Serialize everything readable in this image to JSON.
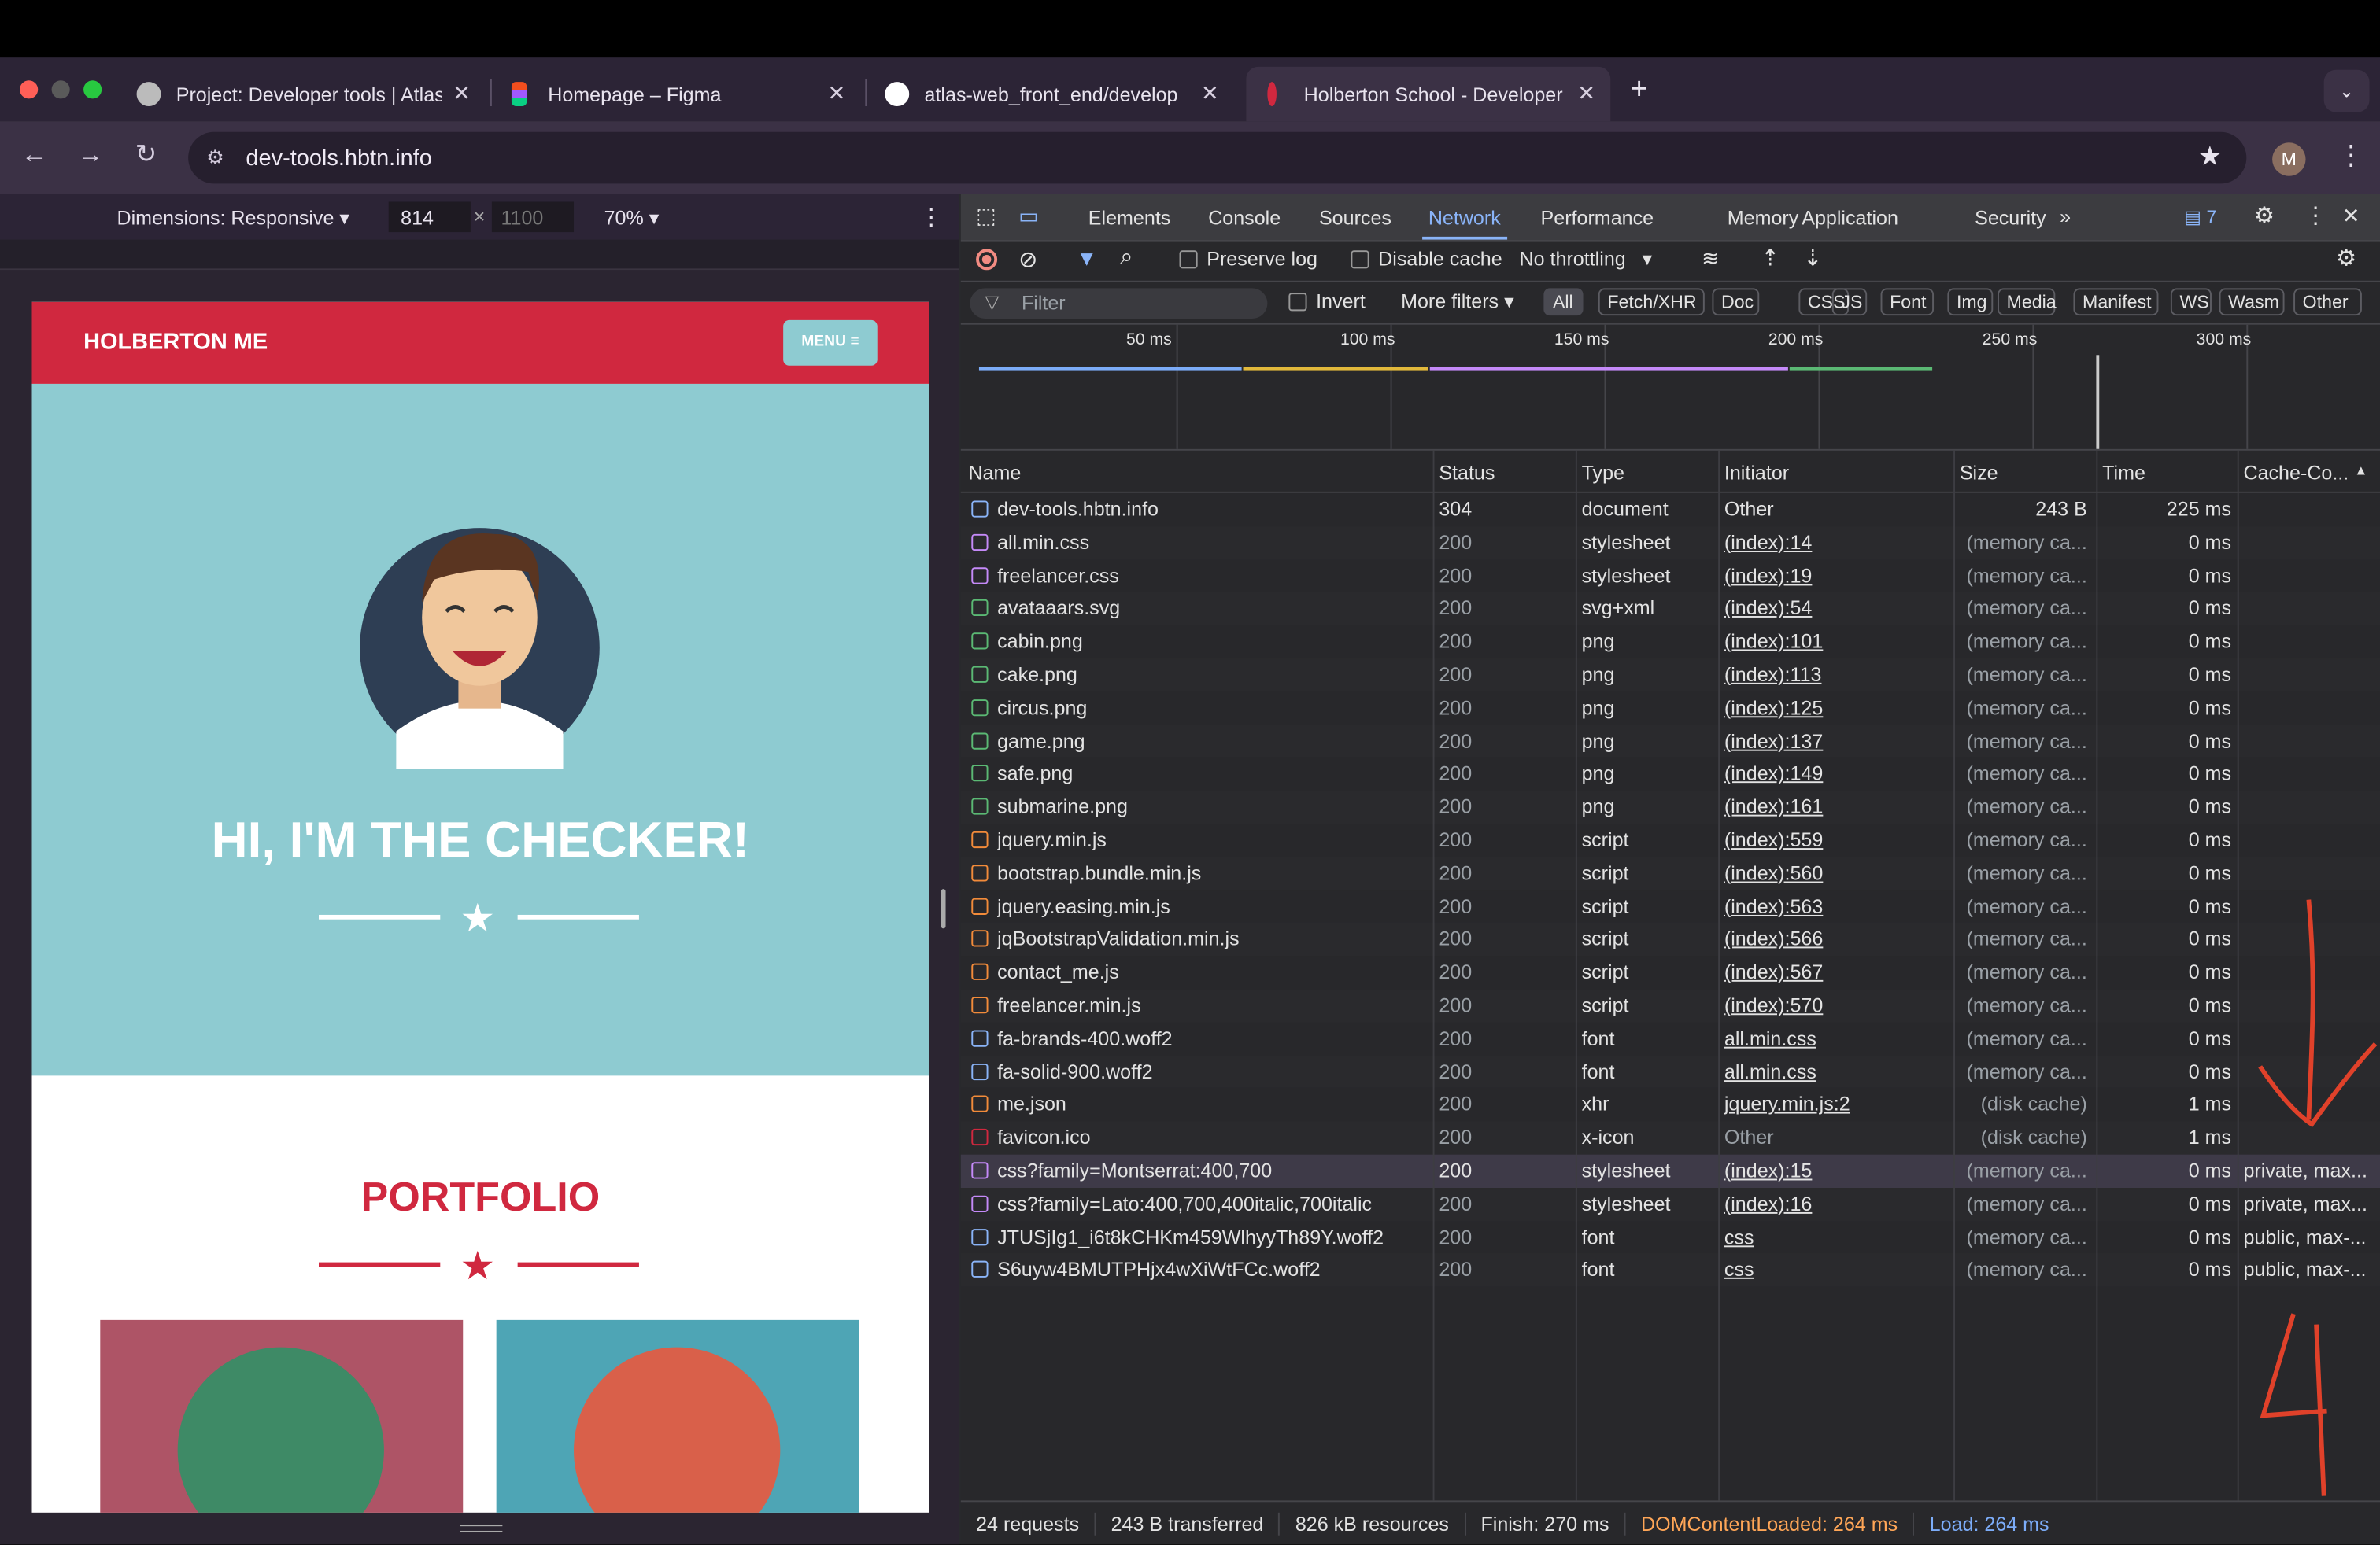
{
  "tabs": [
    {
      "title": "Project: Developer tools | Atlas",
      "icon": "globe-icon"
    },
    {
      "title": "Homepage – Figma",
      "icon": "figma-icon"
    },
    {
      "title": "atlas-web_front_end/develop",
      "icon": "github-icon"
    },
    {
      "title": "Holberton School - Developer",
      "icon": "holberton-icon",
      "active": true
    }
  ],
  "address": {
    "url": "dev-tools.hbtn.info"
  },
  "profile": {
    "initial": "M"
  },
  "device_toolbar": {
    "dimensions_label": "Dimensions: Responsive",
    "width": "814",
    "times": "×",
    "height": "1100",
    "zoom": "70%"
  },
  "site": {
    "brand": "HOLBERTON ME",
    "menu_label": "MENU",
    "hero_title": "HI, I'M THE CHECKER!",
    "portfolio_title": "PORTFOLIO"
  },
  "devtools": {
    "panels": [
      "Elements",
      "Console",
      "Sources",
      "Network",
      "Performance",
      "Memory",
      "Application",
      "Security"
    ],
    "active_panel": "Network",
    "more_panels": "»",
    "issue_count": "7",
    "preserve_log": "Preserve log",
    "disable_cache": "Disable cache",
    "throttling": "No throttling",
    "filter_placeholder": "Filter",
    "invert": "Invert",
    "more_filters": "More filters",
    "type_filters": [
      "All",
      "Fetch/XHR",
      "Doc",
      "CSS",
      "JS",
      "Font",
      "Img",
      "Media",
      "Manifest",
      "WS",
      "Wasm",
      "Other"
    ],
    "timeline_ticks": [
      "50 ms",
      "100 ms",
      "150 ms",
      "200 ms",
      "250 ms",
      "300 ms"
    ],
    "columns": [
      "Name",
      "Status",
      "Type",
      "Initiator",
      "Size",
      "Time",
      "Cache-Co..."
    ],
    "rows": [
      {
        "name": "dev-tools.hbtn.info",
        "status": "304",
        "type": "document",
        "initiator": "Other",
        "size": "243 B",
        "time": "225 ms",
        "cache": "",
        "kind": "doc"
      },
      {
        "name": "all.min.css",
        "status": "200",
        "type": "stylesheet",
        "initiator": "(index):14",
        "size": "(memory ca...",
        "time": "0 ms",
        "cache": "",
        "kind": "css"
      },
      {
        "name": "freelancer.css",
        "status": "200",
        "type": "stylesheet",
        "initiator": "(index):19",
        "size": "(memory ca...",
        "time": "0 ms",
        "cache": "",
        "kind": "css"
      },
      {
        "name": "avataaars.svg",
        "status": "200",
        "type": "svg+xml",
        "initiator": "(index):54",
        "size": "(memory ca...",
        "time": "0 ms",
        "cache": "",
        "kind": "img"
      },
      {
        "name": "cabin.png",
        "status": "200",
        "type": "png",
        "initiator": "(index):101",
        "size": "(memory ca...",
        "time": "0 ms",
        "cache": "",
        "kind": "img"
      },
      {
        "name": "cake.png",
        "status": "200",
        "type": "png",
        "initiator": "(index):113",
        "size": "(memory ca...",
        "time": "0 ms",
        "cache": "",
        "kind": "img"
      },
      {
        "name": "circus.png",
        "status": "200",
        "type": "png",
        "initiator": "(index):125",
        "size": "(memory ca...",
        "time": "0 ms",
        "cache": "",
        "kind": "img"
      },
      {
        "name": "game.png",
        "status": "200",
        "type": "png",
        "initiator": "(index):137",
        "size": "(memory ca...",
        "time": "0 ms",
        "cache": "",
        "kind": "img"
      },
      {
        "name": "safe.png",
        "status": "200",
        "type": "png",
        "initiator": "(index):149",
        "size": "(memory ca...",
        "time": "0 ms",
        "cache": "",
        "kind": "img"
      },
      {
        "name": "submarine.png",
        "status": "200",
        "type": "png",
        "initiator": "(index):161",
        "size": "(memory ca...",
        "time": "0 ms",
        "cache": "",
        "kind": "img"
      },
      {
        "name": "jquery.min.js",
        "status": "200",
        "type": "script",
        "initiator": "(index):559",
        "size": "(memory ca...",
        "time": "0 ms",
        "cache": "",
        "kind": "js"
      },
      {
        "name": "bootstrap.bundle.min.js",
        "status": "200",
        "type": "script",
        "initiator": "(index):560",
        "size": "(memory ca...",
        "time": "0 ms",
        "cache": "",
        "kind": "js"
      },
      {
        "name": "jquery.easing.min.js",
        "status": "200",
        "type": "script",
        "initiator": "(index):563",
        "size": "(memory ca...",
        "time": "0 ms",
        "cache": "",
        "kind": "js"
      },
      {
        "name": "jqBootstrapValidation.min.js",
        "status": "200",
        "type": "script",
        "initiator": "(index):566",
        "size": "(memory ca...",
        "time": "0 ms",
        "cache": "",
        "kind": "js"
      },
      {
        "name": "contact_me.js",
        "status": "200",
        "type": "script",
        "initiator": "(index):567",
        "size": "(memory ca...",
        "time": "0 ms",
        "cache": "",
        "kind": "js"
      },
      {
        "name": "freelancer.min.js",
        "status": "200",
        "type": "script",
        "initiator": "(index):570",
        "size": "(memory ca...",
        "time": "0 ms",
        "cache": "",
        "kind": "js"
      },
      {
        "name": "fa-brands-400.woff2",
        "status": "200",
        "type": "font",
        "initiator": "all.min.css",
        "size": "(memory ca...",
        "time": "0 ms",
        "cache": "",
        "kind": "font"
      },
      {
        "name": "fa-solid-900.woff2",
        "status": "200",
        "type": "font",
        "initiator": "all.min.css",
        "size": "(memory ca...",
        "time": "0 ms",
        "cache": "",
        "kind": "font"
      },
      {
        "name": "me.json",
        "status": "200",
        "type": "xhr",
        "initiator": "jquery.min.js:2",
        "size": "(disk cache)",
        "time": "1 ms",
        "cache": "",
        "kind": "xhr"
      },
      {
        "name": "favicon.ico",
        "status": "200",
        "type": "x-icon",
        "initiator": "Other",
        "size": "(disk cache)",
        "time": "1 ms",
        "cache": "",
        "kind": "ico"
      },
      {
        "name": "css?family=Montserrat:400,700",
        "status": "200",
        "type": "stylesheet",
        "initiator": "(index):15",
        "size": "(memory ca...",
        "time": "0 ms",
        "cache": "private, max...",
        "kind": "css",
        "selected": true
      },
      {
        "name": "css?family=Lato:400,700,400italic,700italic",
        "status": "200",
        "type": "stylesheet",
        "initiator": "(index):16",
        "size": "(memory ca...",
        "time": "0 ms",
        "cache": "private, max...",
        "kind": "css"
      },
      {
        "name": "JTUSjIg1_i6t8kCHKm459WlhyyTh89Y.woff2",
        "status": "200",
        "type": "font",
        "initiator": "css",
        "size": "(memory ca...",
        "time": "0 ms",
        "cache": "public, max-...",
        "kind": "font"
      },
      {
        "name": "S6uyw4BMUTPHjx4wXiWtFCc.woff2",
        "status": "200",
        "type": "font",
        "initiator": "css",
        "size": "(memory ca...",
        "time": "0 ms",
        "cache": "public, max-...",
        "kind": "font"
      }
    ],
    "summary": {
      "requests": "24 requests",
      "transferred": "243 B transferred",
      "resources": "826 kB resources",
      "finish": "Finish: 270 ms",
      "dom_loaded": "DOMContentLoaded: 264 ms",
      "load": "Load: 264 ms"
    }
  },
  "annotation": {
    "number": "4"
  },
  "colors": {
    "brand_red": "#d0283f",
    "hero_teal": "#8ecbd1",
    "devtools_blue": "#7cacf8",
    "dom_loaded_orange": "#ffa657",
    "load_blue": "#7cacf8"
  }
}
